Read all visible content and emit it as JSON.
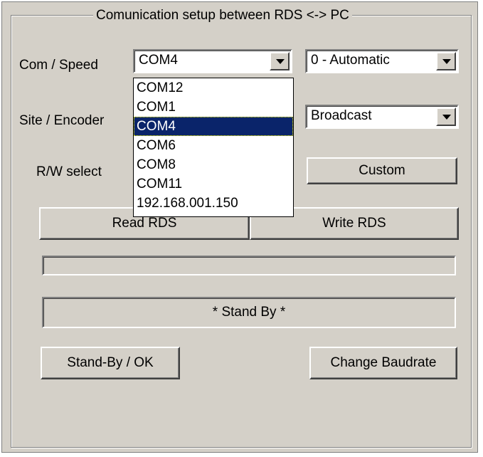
{
  "group_title": "Comunication setup between RDS <-> PC",
  "labels": {
    "com_speed": "Com / Speed",
    "site_encoder": "Site / Encoder",
    "rw_select": "R/W select"
  },
  "com_port": {
    "selected": "COM4",
    "options": [
      "COM12",
      "COM1",
      "COM4",
      "COM6",
      "COM8",
      "COM11",
      "192.168.001.150"
    ],
    "highlighted_index": 2
  },
  "speed": {
    "selected": "0 - Automatic"
  },
  "encoder": {
    "selected": "Broadcast"
  },
  "buttons": {
    "custom": "Custom",
    "read_rds": "Read RDS",
    "write_rds": "Write RDS",
    "standby_ok": "Stand-By / OK",
    "change_baudrate": "Change Baudrate"
  },
  "status_text": "*  Stand By  *",
  "progress": {
    "value": 0
  },
  "colors": {
    "face": "#d4d0c8",
    "highlight": "#0a246a"
  }
}
